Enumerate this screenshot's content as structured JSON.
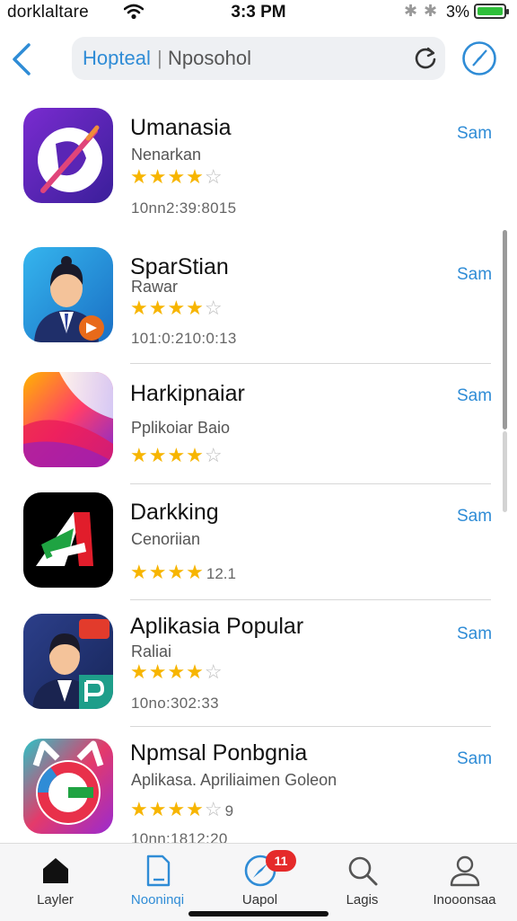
{
  "status_bar": {
    "carrier": "dorklaltare",
    "time": "3:3 PM",
    "battery": "3%"
  },
  "search": {
    "query_primary": "Hopteal",
    "separator": "|",
    "query_secondary": "Nposohol"
  },
  "apps": [
    {
      "name": "Umanasia",
      "subtitle": "Nenarkan",
      "rating": 4,
      "rating_count": "",
      "meta": "10nn2:39:8015",
      "get_label": "Sam"
    },
    {
      "name": "SparStian",
      "subtitle": "Rawar",
      "rating": 4,
      "rating_count": "",
      "meta": "101:0:210:0:13",
      "get_label": "Sam"
    },
    {
      "name": "Harkipnaiar",
      "subtitle": "Pplikoiar Baio",
      "rating": 4,
      "rating_count": "",
      "meta": "",
      "get_label": "Sam"
    },
    {
      "name": "Darkking",
      "subtitle": "Cenoriian",
      "rating": 4,
      "rating_count": "12.1",
      "meta": "",
      "get_label": "Sam"
    },
    {
      "name": "Aplikasia Popular",
      "subtitle": "Raliai",
      "rating": 4,
      "rating_count": "",
      "meta": "10no:302:33",
      "get_label": "Sam"
    },
    {
      "name": "Npmsal Ponbgnia",
      "subtitle": "Aplikasa. Apriliaimen Goleon",
      "rating": 4,
      "rating_count": "9",
      "meta": "10nn:1812:20",
      "get_label": "Sam"
    }
  ],
  "icons": {
    "back": "chevron-left-icon",
    "refresh": "refresh-icon",
    "compass": "compass-icon"
  },
  "tabs": [
    {
      "label": "Layler",
      "icon": "home-icon",
      "active": false
    },
    {
      "label": "Nooninqi",
      "icon": "document-icon",
      "active": true
    },
    {
      "label": "Uapol",
      "icon": "compass-icon",
      "active": false
    },
    {
      "label": "Lagis",
      "icon": "search-icon",
      "active": false
    },
    {
      "label": "Inooonsaa",
      "icon": "person-icon",
      "active": false
    }
  ],
  "tab_badge": "11",
  "colors": {
    "accent": "#2f8cd6",
    "star": "#f7b500",
    "badge": "#e52a2a",
    "battery": "#2fbf3a"
  }
}
